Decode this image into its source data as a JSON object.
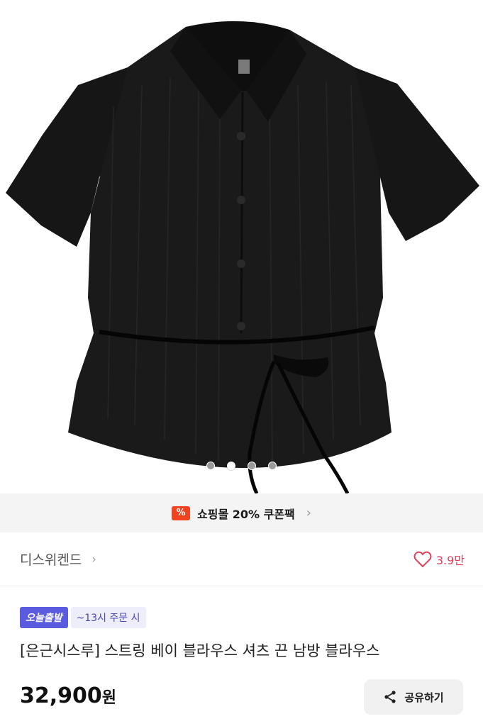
{
  "product_image": {
    "carousel_total": 4,
    "carousel_active_index": 1
  },
  "coupon": {
    "icon_text": "%",
    "label": "쇼핑몰 20% 쿠폰팩"
  },
  "store": {
    "name": "디스위켄드",
    "likes": "3.9만"
  },
  "delivery": {
    "badge": "오늘출발",
    "cutoff": "~13시 주문 시"
  },
  "product": {
    "title": "[은근시스루] 스트링 베이 블라우스 셔츠 끈 남방 블라우스",
    "price": "32,900",
    "price_unit": "원"
  },
  "share": {
    "label": "공유하기"
  },
  "colors": {
    "accent": "#f0431f",
    "like": "#e0405a",
    "badge": "#5b5be0"
  }
}
